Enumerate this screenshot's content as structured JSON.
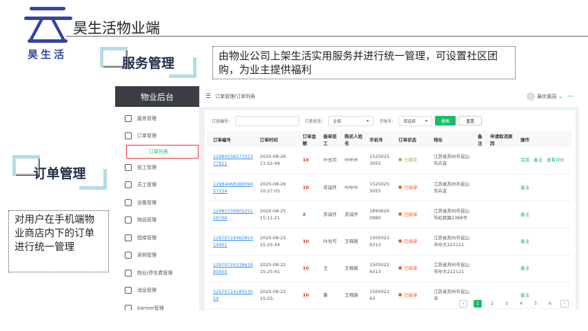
{
  "slide": {
    "logo_text": "昊生活",
    "title": "昊生活物业端",
    "section_title": "服务管理",
    "section_desc": "由物业公司上架生活实用服务并进行统一管理，可设置社区团购，为业主提供福利",
    "sub_title": "订单管理",
    "sub_desc": "对用户在手机端物业商店内下的订单进行统一管理"
  },
  "app": {
    "sidebar": {
      "title": "物业后台",
      "items": [
        {
          "label": "服务管理",
          "icon": "service-icon"
        },
        {
          "label": "订单管理",
          "icon": "order-icon"
        },
        {
          "label": "订单列表",
          "icon": "",
          "active": true
        },
        {
          "label": "技工管理",
          "icon": "technician-icon"
        },
        {
          "label": "员工管理",
          "icon": "user-icon"
        },
        {
          "label": "设备管理",
          "icon": "device-icon"
        },
        {
          "label": "物品管理",
          "icon": "box-icon"
        },
        {
          "label": "图库管理",
          "icon": "image-icon"
        },
        {
          "label": "采购管理",
          "icon": "cart-icon"
        },
        {
          "label": "物业/停车费管理",
          "icon": "parking-icon"
        },
        {
          "label": "消息管理",
          "icon": "message-icon"
        },
        {
          "label": "banner管理",
          "icon": "banner-icon"
        }
      ]
    },
    "topbar": {
      "breadcrumb": "订单管理/订单列表",
      "user": "最优嘉园"
    },
    "filter": {
      "order_no_label": "订单编号：",
      "order_no_value": "",
      "status_label": "订单状态：",
      "status_value": "全部",
      "account_label": "子账号：",
      "account_value": "请选择",
      "search": "搜索",
      "reset": "重置"
    },
    "columns": [
      "订单编号",
      "订单时间",
      "订单金额",
      "接单技工",
      "购买人姓名",
      "手机号",
      "订单状态",
      "地址",
      "备注",
      "申请取消原因",
      "操作"
    ],
    "rows": [
      {
        "no": "1298455827703377921",
        "time": "2020-08-26 11:02:48",
        "amount": "10",
        "tech": "叶也可",
        "buyer": "叶叶叶",
        "phone": "15250253055",
        "status": "已确定",
        "status_color": "#8bc34a",
        "address": "江苏省苏州市昆山市卉友",
        "ops": [
          "完成",
          "备注",
          "查看评价"
        ]
      },
      {
        "no": "1298446838609457154",
        "time": "2020-08-26 10:27:05",
        "amount": "10",
        "tech": "苏诚开",
        "buyer": "叶叶叶",
        "phone": "15250253055",
        "status": "已接单",
        "status_color": "#ff5722",
        "address": "江苏省苏州市昆山市卉友",
        "ops": [
          "备注"
        ]
      },
      {
        "no": "1298155990525128706",
        "time": "2020-08-25 15:11:21",
        "amount": "2",
        "tech": "苏诚开",
        "buyer": "苏诚开",
        "phone": "18906260980",
        "status": "已接单",
        "status_color": "#ff5722",
        "address": "江苏省苏州市昆山市虹桥路2388号",
        "ops": [
          "备注"
        ]
      },
      {
        "no": "1297072446285414401",
        "time": "2020-08-22 15:25:44",
        "amount": "10",
        "tech": "叶也可",
        "buyer": "王晓路",
        "phone": "15050226313",
        "status": "已接单",
        "status_color": "#ff5722",
        "address": "江苏省苏州市昆山市中大222121",
        "ops": [
          "备注"
        ]
      },
      {
        "no": "1297072433861885955",
        "time": "2020-08-22 15:25:41",
        "amount": "10",
        "tech": "王",
        "buyer": "王晓路",
        "phone": "15050226313",
        "status": "已接单",
        "status_color": "#ff5722",
        "address": "江苏省苏州市昆山市中大222121",
        "ops": [
          "备注"
        ]
      },
      {
        "no": "1297072418053554",
        "time": "2020-08-22 15:25:",
        "amount": "10",
        "tech": "鲁",
        "buyer": "王晓路",
        "phone": "150502263",
        "status": "已接单",
        "status_color": "#ff5722",
        "address": "江苏省苏州市昆山市",
        "ops": [
          "备注"
        ]
      }
    ],
    "pager": {
      "prev": "‹",
      "pages": [
        "1",
        "2",
        "3",
        "4",
        "5",
        "6"
      ],
      "current": "1",
      "next": "›"
    },
    "colors": {
      "accent": "#19be6b",
      "link": "#2d8cf0",
      "sidebar_head": "#3a3d44"
    }
  }
}
